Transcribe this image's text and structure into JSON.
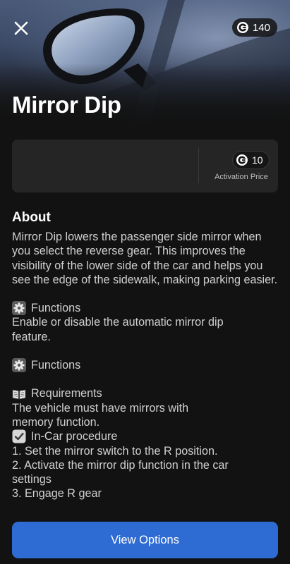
{
  "header": {
    "credits": "140",
    "title": "Mirror Dip"
  },
  "price_card": {
    "price": "10",
    "label": "Activation Price"
  },
  "about": {
    "heading": "About",
    "description": "Mirror Dip lowers the passenger side mirror when you select the reverse gear. This improves the visibility of the lower side of the car and helps you see the edge of the sidewalk, making parking easier.",
    "functions_1_title": "Functions",
    "functions_1_text": "Enable or disable the automatic mirror dip feature.",
    "functions_2_title": "Functions",
    "requirements_title": "Requirements",
    "requirements_text": "The vehicle must have mirrors with memory function.",
    "procedure_title": "In-Car procedure",
    "steps": [
      "1. Set the mirror switch to the R position.",
      "2. Activate the mirror dip function in the car settings",
      "3. Engage R gear"
    ]
  },
  "cta": {
    "label": "View Options"
  },
  "icons": {
    "close": "close-icon",
    "coin": "coin-icon",
    "gear": "gear-icon",
    "book": "book-icon",
    "check": "checkbox-icon"
  },
  "colors": {
    "accent": "#2e6bd2",
    "background": "#121212",
    "card": "#252525"
  }
}
